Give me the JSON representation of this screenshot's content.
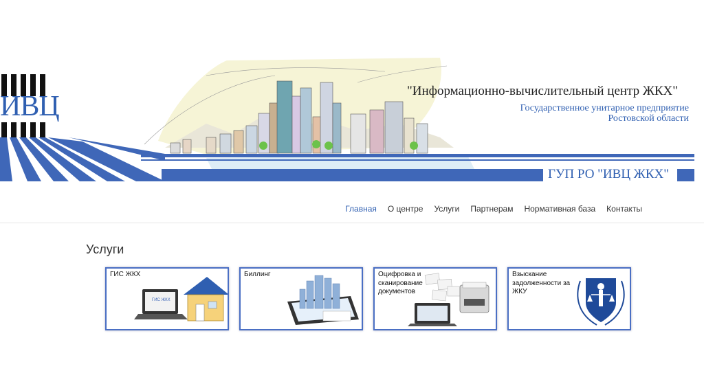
{
  "header": {
    "logo_text": "ИВЦ",
    "title": "\"Информационно-вычислительный центр ЖКХ\"",
    "subtitle_line1": "Государственное унитарное предприятие",
    "subtitle_line2": "Ростовской области",
    "org_label": "ГУП РО \"ИВЦ ЖКХ\""
  },
  "nav": {
    "items": [
      {
        "label": "Главная",
        "active": true
      },
      {
        "label": "О центре"
      },
      {
        "label": "Услуги"
      },
      {
        "label": "Партнерам"
      },
      {
        "label": "Нормативная база"
      },
      {
        "label": "Контакты"
      }
    ]
  },
  "services": {
    "title": "Услуги",
    "cards": [
      {
        "label": "ГИС ЖКХ",
        "icon": "laptop-house-icon"
      },
      {
        "label": "Биллинг",
        "icon": "tablet-city-icon"
      },
      {
        "label": "Оцифровка и сканирование документов",
        "icon": "scanner-documents-icon"
      },
      {
        "label": "Взыскание задолженности за ЖКУ",
        "icon": "justice-emblem-icon"
      }
    ]
  },
  "colors": {
    "brand_blue": "#3f67b8",
    "nav_active": "#2f5fb1"
  }
}
